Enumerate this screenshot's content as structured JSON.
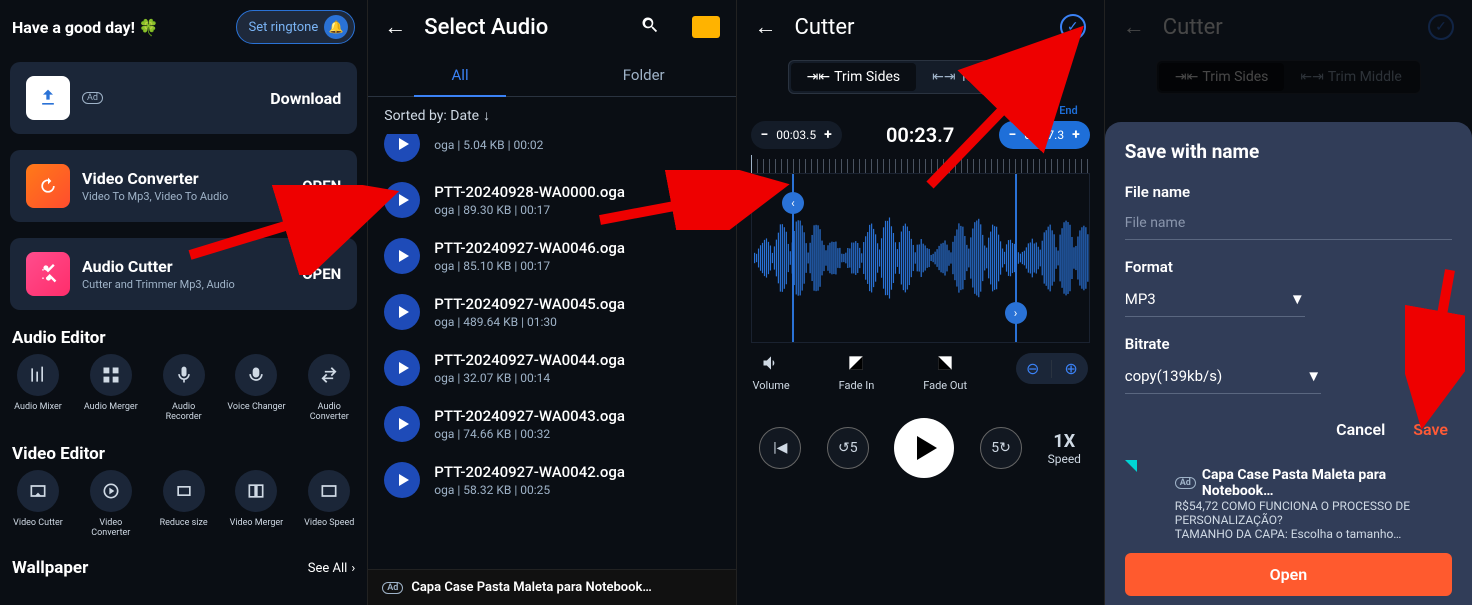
{
  "panel1": {
    "greeting": "Have a good day!",
    "ringtone_btn": "Set ringtone",
    "download": {
      "title": "Download",
      "ad": "Ad"
    },
    "converter": {
      "title": "Video Converter",
      "sub": "Video To Mp3, Video To Audio",
      "action": "OPEN"
    },
    "cutter": {
      "title": "Audio Cutter",
      "sub": "Cutter and Trimmer Mp3, Audio",
      "action": "OPEN"
    },
    "section_audio": "Audio Editor",
    "audio_tools": [
      {
        "label": "Audio Mixer"
      },
      {
        "label": "Audio Merger"
      },
      {
        "label": "Audio Recorder"
      },
      {
        "label": "Voice Changer"
      },
      {
        "label": "Audio Converter"
      }
    ],
    "section_video": "Video Editor",
    "video_tools": [
      {
        "label": "Video Cutter"
      },
      {
        "label": "Video Converter"
      },
      {
        "label": "Reduce size"
      },
      {
        "label": "Video Merger"
      },
      {
        "label": "Video Speed"
      }
    ],
    "section_wallpaper": "Wallpaper",
    "see_all": "See All"
  },
  "panel2": {
    "title": "Select Audio",
    "tab_all": "All",
    "tab_folder": "Folder",
    "sort_label": "Sorted by: Date",
    "items": [
      {
        "name": "",
        "meta": "oga | 5.04 KB | 00:02"
      },
      {
        "name": "PTT-20240928-WA0000.oga",
        "meta": "oga | 89.30 KB | 00:17"
      },
      {
        "name": "PTT-20240927-WA0046.oga",
        "meta": "oga | 85.10 KB | 00:17"
      },
      {
        "name": "PTT-20240927-WA0045.oga",
        "meta": "oga | 489.64 KB | 01:30"
      },
      {
        "name": "PTT-20240927-WA0044.oga",
        "meta": "oga | 32.07 KB | 00:14"
      },
      {
        "name": "PTT-20240927-WA0043.oga",
        "meta": "oga | 74.66 KB | 00:32"
      },
      {
        "name": "PTT-20240927-WA0042.oga",
        "meta": "oga | 58.32 KB | 00:25"
      }
    ],
    "ad_text": "Capa Case Pasta Maleta para Notebook…",
    "ad_badge": "Ad"
  },
  "panel3": {
    "title": "Cutter",
    "tab_sides": "Trim Sides",
    "tab_middle": "Trim Middle",
    "end_label": "End",
    "start_time": "00:03.5",
    "dur": "00:23.7",
    "end_time": "00:27.3",
    "ctrl_volume": "Volume",
    "ctrl_fadein": "Fade In",
    "ctrl_fadeout": "Fade Out",
    "speed_val": "1X",
    "speed_lbl": "Speed"
  },
  "panel4": {
    "title": "Cutter",
    "modal_title": "Save with name",
    "fname_label": "File name",
    "fname_ph": "File name",
    "format_label": "Format",
    "format_val": "MP3",
    "bitrate_label": "Bitrate",
    "bitrate_val": "copy(139kb/s)",
    "cancel": "Cancel",
    "save": "Save",
    "ad_badge": "Ad",
    "ad_title": "Capa Case Pasta Maleta para Notebook…",
    "ad_line1": "R$54,72 COMO FUNCIONA O PROCESSO DE PERSONALIZAÇÃO?",
    "ad_line2": "TAMANHO DA CAPA: Escolha o tamanho…",
    "open_btn": "Open"
  }
}
